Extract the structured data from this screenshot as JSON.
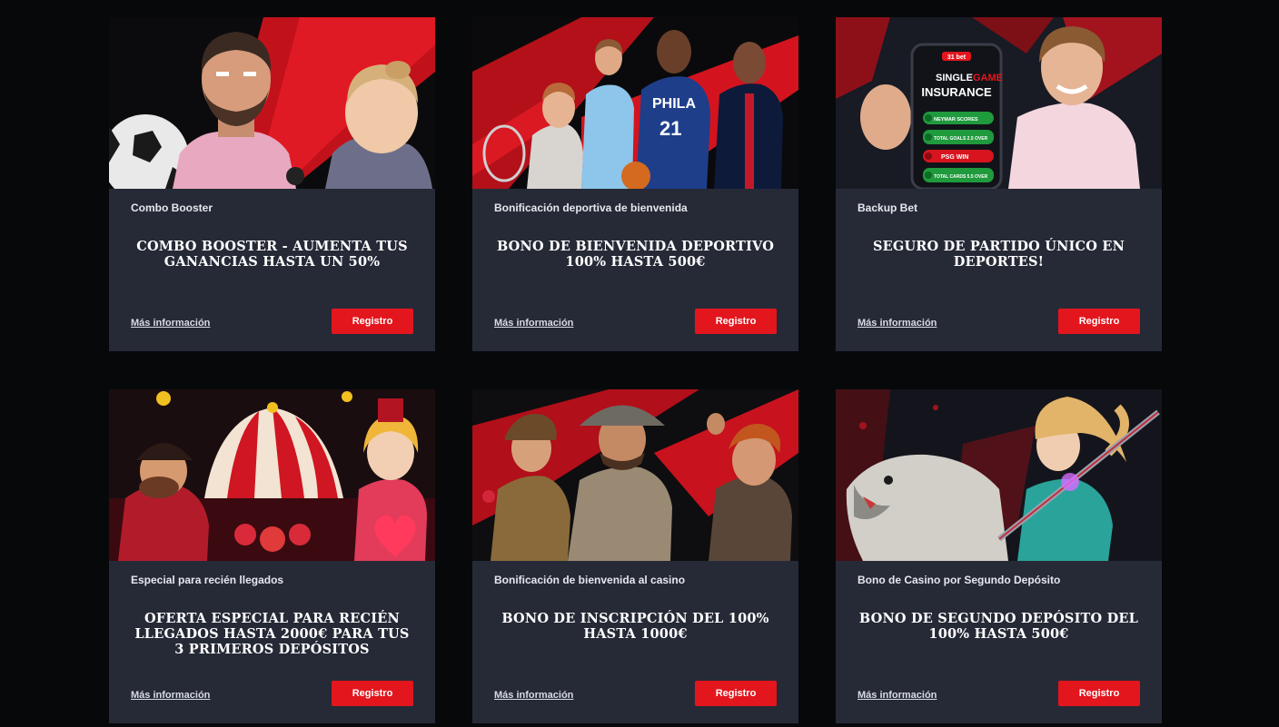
{
  "cards": [
    {
      "category": "Combo Booster",
      "title": "COMBO BOOSTER - AUMENTA TUS GANANCIAS HASTA UN 50%",
      "more_link": "Más información",
      "register_button": "Registro",
      "image": "football-stars-illustration"
    },
    {
      "category": "Bonificación deportiva de bienvenida",
      "title": "BONO DE BIENVENIDA DEPORTIVO 100% HASTA 500€",
      "more_link": "Más información",
      "register_button": "Registro",
      "image": "sport-athletes-banner",
      "jersey_text": "PHILA",
      "jersey_number": "21"
    },
    {
      "category": "Backup Bet",
      "title": "SEGURO DE PARTIDO ÚNICO EN DEPORTES!",
      "more_link": "Más información",
      "register_button": "Registro",
      "image": "phone-insurance-banner",
      "phone": {
        "brand": "31 bet",
        "headline_1a": "SINGLE",
        "headline_1b": "GAME",
        "headline_2": "INSURANCE",
        "rows": [
          "NEYMAR SCORES",
          "TOTAL GOALS 2.5 OVER",
          "PSG WIN",
          "TOTAL CARDS 5.5 OVER"
        ]
      }
    },
    {
      "category": "Especial para recién llegados",
      "title": "OFERTA ESPECIAL PARA RECIÉN LLEGADOS HASTA 2000€ PARA TUS 3 PRIMEROS DEPÓSITOS",
      "more_link": "Más información",
      "register_button": "Registro",
      "image": "circus-casino-banner"
    },
    {
      "category": "Bonificación de bienvenida al casino",
      "title": "BONO DE INSCRIPCIÓN DEL 100% HASTA 1000€",
      "more_link": "Más información",
      "register_button": "Registro",
      "image": "adventurers-casino-banner"
    },
    {
      "category": "Bono de Casino por Segundo Depósito",
      "title": "BONO DE SEGUNDO DEPÓSITO DEL 100% HASTA 500€",
      "more_link": "Más información",
      "register_button": "Registro",
      "image": "archer-tiger-banner"
    }
  ],
  "colors": {
    "page_background": "#07080a",
    "card_background": "#262a37",
    "accent_red": "#e3161e",
    "text_white": "#ffffff"
  }
}
